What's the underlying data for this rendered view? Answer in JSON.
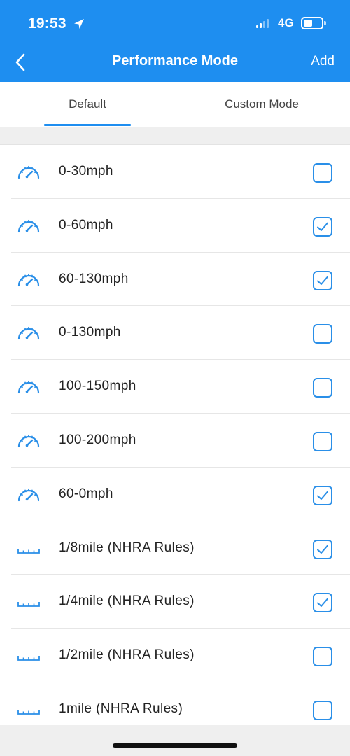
{
  "status_bar": {
    "time": "19:53",
    "network": "4G"
  },
  "nav": {
    "title": "Performance Mode",
    "action_label": "Add"
  },
  "tabs": [
    {
      "label": "Default",
      "selected": true
    },
    {
      "label": "Custom Mode",
      "selected": false
    }
  ],
  "accent_color": "#1e8ef0",
  "items": [
    {
      "label": "0-30mph",
      "icon": "speedometer-icon",
      "checked": false
    },
    {
      "label": "0-60mph",
      "icon": "speedometer-icon",
      "checked": true
    },
    {
      "label": "60-130mph",
      "icon": "speedometer-icon",
      "checked": true
    },
    {
      "label": "0-130mph",
      "icon": "speedometer-icon",
      "checked": false
    },
    {
      "label": "100-150mph",
      "icon": "speedometer-icon",
      "checked": false
    },
    {
      "label": "100-200mph",
      "icon": "speedometer-icon",
      "checked": false
    },
    {
      "label": "60-0mph",
      "icon": "speedometer-icon",
      "checked": true
    },
    {
      "label": "1/8mile (NHRA Rules)",
      "icon": "ruler-icon",
      "checked": true
    },
    {
      "label": "1/4mile (NHRA Rules)",
      "icon": "ruler-icon",
      "checked": true
    },
    {
      "label": "1/2mile (NHRA Rules)",
      "icon": "ruler-icon",
      "checked": false
    },
    {
      "label": "1mile (NHRA Rules)",
      "icon": "ruler-icon",
      "checked": false
    }
  ]
}
